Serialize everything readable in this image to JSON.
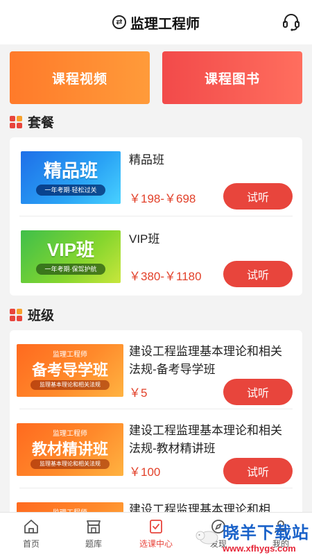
{
  "header": {
    "title": "监理工程师",
    "switch_glyph": "⇄",
    "support_icon": "headset-icon"
  },
  "banners": [
    {
      "label": "课程视频"
    },
    {
      "label": "课程图书"
    }
  ],
  "packages": {
    "title": "套餐",
    "items": [
      {
        "name": "精品班",
        "price": "￥198-￥698",
        "thumb_title": "精品班",
        "thumb_ribbon": "一年考期·轻松过关",
        "button": "试听"
      },
      {
        "name": "VIP班",
        "price": "￥380-￥1180",
        "thumb_title": "VIP班",
        "thumb_ribbon": "一年考期·保驾护航",
        "button": "试听"
      }
    ]
  },
  "classes": {
    "title": "班级",
    "items": [
      {
        "name": "建设工程监理基本理论和相关法规-备考导学班",
        "price": "￥5",
        "thumb_sub": "监理工程师",
        "thumb_title": "备考导学班",
        "thumb_ribbon": "监理基本理论和相关法规",
        "button": "试听"
      },
      {
        "name": "建设工程监理基本理论和相关法规-教材精讲班",
        "price": "￥100",
        "thumb_sub": "监理工程师",
        "thumb_title": "教材精讲班",
        "thumb_ribbon": "监理基本理论和相关法规",
        "button": "试听"
      },
      {
        "name": "建设工程监理基本理论和相",
        "thumb_sub": "监理工程师",
        "thumb_title": "",
        "thumb_ribbon": ""
      }
    ]
  },
  "tabbar": [
    {
      "label": "首页",
      "icon": "home-icon"
    },
    {
      "label": "题库",
      "icon": "question-bank-icon"
    },
    {
      "label": "选课中心",
      "icon": "course-center-icon",
      "active": true
    },
    {
      "label": "发现",
      "icon": "discover-icon"
    },
    {
      "label": "我的",
      "icon": "profile-icon"
    }
  ],
  "watermark": {
    "main": "晓羊下载站",
    "url": "www.xfhygs.com"
  },
  "colors": {
    "accent": "#e8453c",
    "price": "#e2412a",
    "orange": "#ff7a2a"
  }
}
